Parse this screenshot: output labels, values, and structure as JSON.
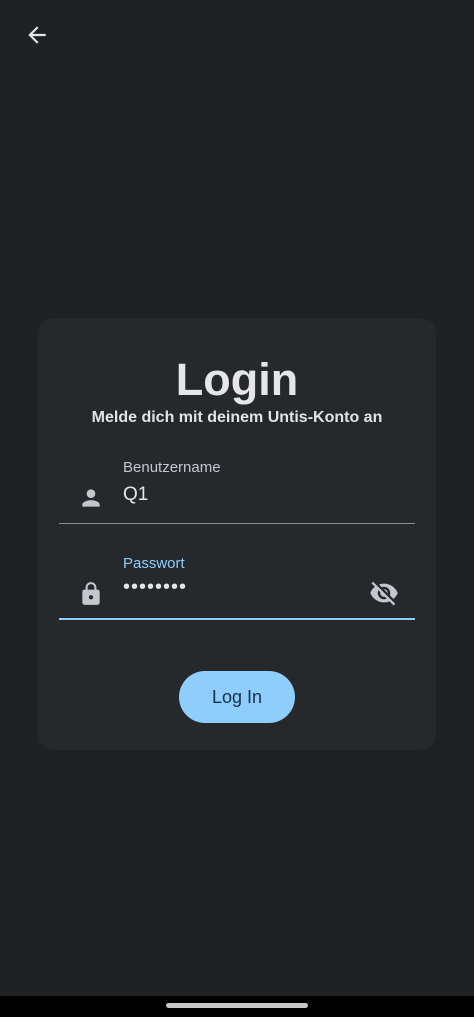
{
  "header": {
    "back_icon": "arrow-left-icon"
  },
  "login": {
    "title": "Login",
    "subtitle": "Melde dich mit deinem Untis-Konto an",
    "username": {
      "label": "Benutzername",
      "value": "Q1",
      "icon": "person-icon"
    },
    "password": {
      "label": "Passwort",
      "value": "••••••••",
      "icon": "lock-icon",
      "toggle_icon": "visibility-off-icon"
    },
    "submit_label": "Log In"
  },
  "colors": {
    "background": "#1f2123",
    "card": "#25292c",
    "accent": "#8fcdfc",
    "button_text": "#143048"
  }
}
